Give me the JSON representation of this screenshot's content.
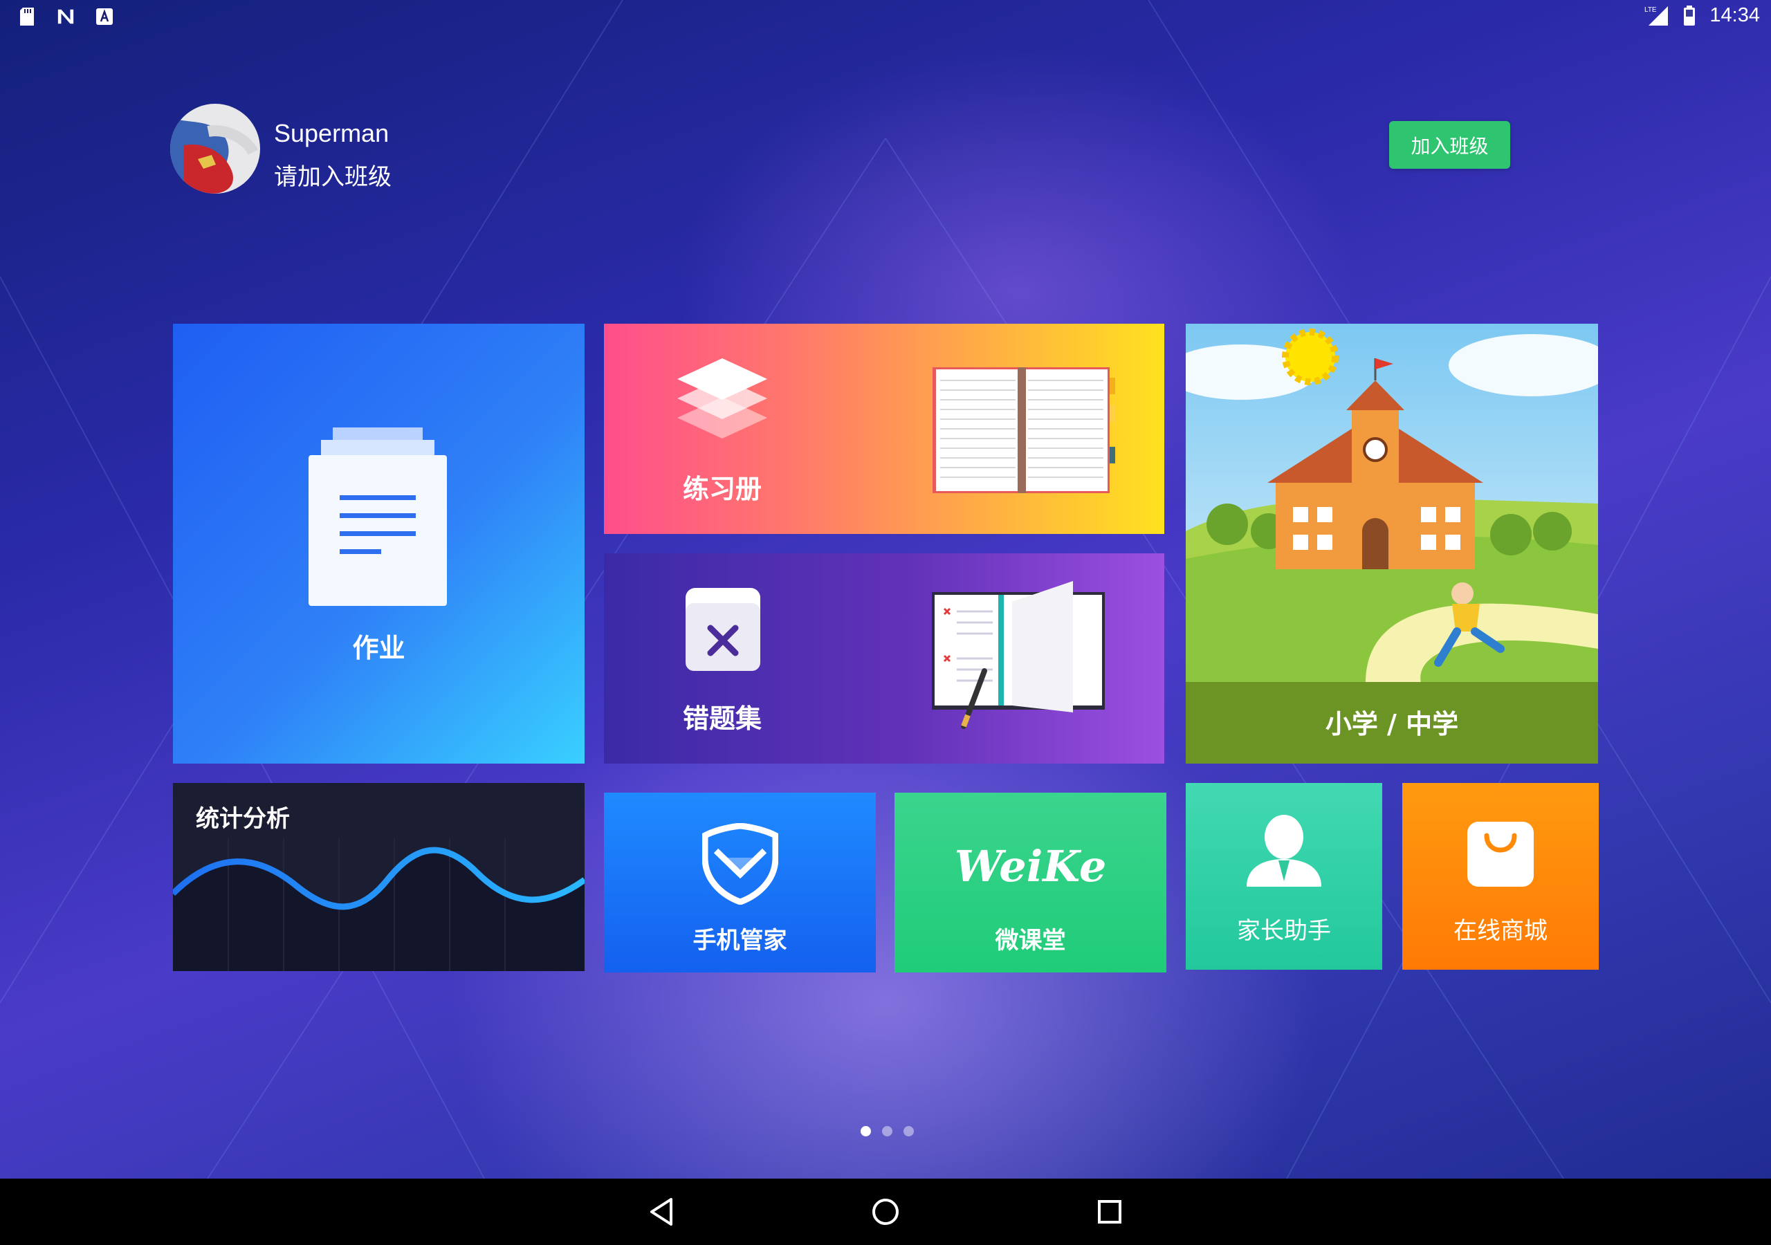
{
  "status_bar": {
    "left_icons": [
      "sd-card-icon",
      "n-notification-icon",
      "a-notification-icon"
    ],
    "right_icons": [
      "lte-signal-icon",
      "battery-icon"
    ],
    "network_label": "LTE",
    "time": "14:34"
  },
  "profile": {
    "name": "Superman",
    "subtitle": "请加入班级",
    "join_button": "加入班级"
  },
  "tiles": {
    "homework": {
      "label": "作业",
      "icon": "document-icon"
    },
    "exercise": {
      "label": "练习册",
      "icon": "layers-icon",
      "illustration": "notebook-illustration"
    },
    "mistakes": {
      "label": "错题集",
      "icon": "wrong-book-icon",
      "illustration": "workbook-illustration"
    },
    "school": {
      "label": "小学 / 中学",
      "illustration": "school-illustration"
    },
    "stats": {
      "label": "统计分析"
    },
    "phone_manager": {
      "label": "手机管家",
      "icon": "shield-icon"
    },
    "weike": {
      "label": "微课堂",
      "logo_text": "WeiKe"
    },
    "parent": {
      "label": "家长助手",
      "icon": "person-icon"
    },
    "shop": {
      "label": "在线商城",
      "icon": "shopping-bag-icon"
    }
  },
  "pager": {
    "pages": 3,
    "active": 1
  },
  "nav_bar": {
    "buttons": [
      "back-icon",
      "home-icon",
      "recents-icon"
    ]
  },
  "colors": {
    "join_button": "#2fc46f",
    "homework": "#2f80f7",
    "parent": "#2ecc9f",
    "shop": "#ff8a08",
    "phone_manager": "#1a74f7",
    "weike": "#2fd183"
  }
}
